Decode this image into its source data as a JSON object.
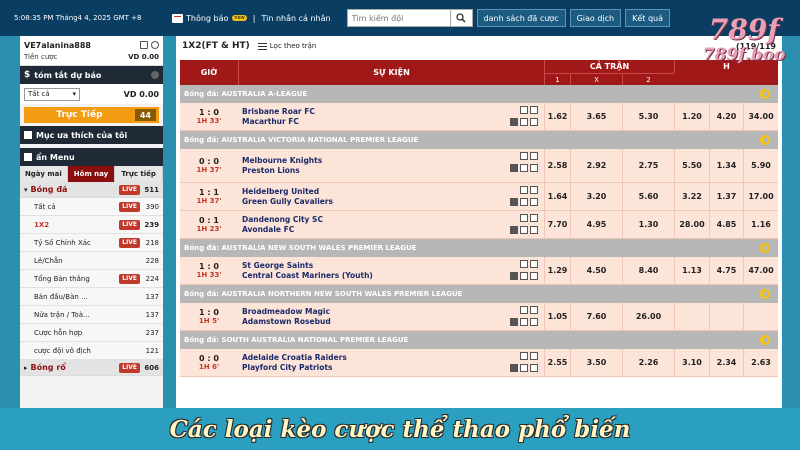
{
  "topbar": {
    "datetime": "5:08:35 PM Tháng4 4, 2025 GMT +8",
    "notice_label": "Thông báo",
    "notice_badge": "new",
    "separator": "|",
    "messages_label": "Tin nhắn cá nhân",
    "search_placeholder": "Tìm kiếm đội",
    "buttons": [
      "danh sách đã cược",
      "Giao dịch",
      "Kết quả"
    ]
  },
  "logo": {
    "line1": "789f",
    "line2": "789f.boo"
  },
  "sidebar": {
    "account_name": "VE7alanina888",
    "balance_label": "Tiền cược",
    "balance_value": "VD 0.00",
    "summary_title": "tóm tắt dự báo",
    "bet_filter_value": "Tất cả",
    "bet_filter_amount": "VD 0.00",
    "live_label": "Trực Tiếp",
    "live_count": "44",
    "favorites_title": "Mục ưa thích của tôi",
    "menu_title": "ẩn Menu",
    "tabs": [
      "Ngày mai",
      "Hôm nay",
      "Trực tiếp"
    ],
    "sports": [
      {
        "name": "Bóng đá",
        "live": "LIVE",
        "count": "511"
      },
      {
        "name": "Bóng rổ",
        "live": "LIVE",
        "count": "606"
      }
    ],
    "markets": [
      {
        "name": "Tất cả",
        "live": "LIVE",
        "count": "390"
      },
      {
        "name": "1X2",
        "live": "LIVE",
        "count": "239"
      },
      {
        "name": "Tỷ Số Chính Xác",
        "live": "LIVE",
        "count": "218"
      },
      {
        "name": "Lẻ/Chẵn",
        "live": "",
        "count": "228"
      },
      {
        "name": "Tổng Bàn thắng",
        "live": "LIVE",
        "count": "224"
      },
      {
        "name": "Bàn đầu/Bàn ...",
        "live": "",
        "count": "137"
      },
      {
        "name": "Nửa trận / Toà...",
        "live": "",
        "count": "137"
      },
      {
        "name": "Cược hỗn hợp",
        "live": "",
        "count": "237"
      },
      {
        "name": "cược đội vô địch",
        "live": "",
        "count": "121"
      }
    ]
  },
  "main": {
    "title": "1X2(FT & HT)",
    "filter_label": "Lọc theo trận",
    "page_count": "(119/119",
    "headers": {
      "time": "GIỜ",
      "event": "SỰ KIỆN",
      "full_match": "CẢ TRẬN",
      "half": "H",
      "cols": [
        "1",
        "X",
        "2"
      ]
    },
    "groups": [
      {
        "league": "Bóng đá: AUSTRALIA A-LEAGUE",
        "matches": [
          {
            "score": "1 : 0",
            "period": "1H 33'",
            "home": "Brisbane Roar FC",
            "away": "Macarthur FC",
            "odds": [
              "1.62",
              "3.65",
              "5.30",
              "1.20",
              "4.20",
              "34.00"
            ]
          }
        ]
      },
      {
        "league": "Bóng đá: AUSTRALIA VICTORIA NATIONAL PREMIER LEAGUE",
        "matches": [
          {
            "score": "0 : 0",
            "period": "1H 37'",
            "home": "Melbourne Knights",
            "away": "Preston Lions",
            "odds": [
              "2.58",
              "2.92",
              "2.75",
              "5.50",
              "1.34",
              "5.90"
            ]
          },
          {
            "score": "1 : 1",
            "period": "1H 37'",
            "home": "Heidelberg United",
            "away": "Green Gully Cavaliers",
            "odds": [
              "1.64",
              "3.20",
              "5.60",
              "3.22",
              "1.37",
              "17.00"
            ]
          },
          {
            "score": "0 : 1",
            "period": "1H 23'",
            "home": "Dandenong City SC",
            "away": "Avondale FC",
            "odds": [
              "7.70",
              "4.95",
              "1.30",
              "28.00",
              "4.85",
              "1.16"
            ]
          }
        ]
      },
      {
        "league": "Bóng đá: AUSTRALIA NEW SOUTH WALES PREMIER LEAGUE",
        "matches": [
          {
            "score": "1 : 0",
            "period": "1H 33'",
            "home": "St George Saints",
            "away": "Central Coast Mariners (Youth)",
            "odds": [
              "1.29",
              "4.50",
              "8.40",
              "1.13",
              "4.75",
              "47.00"
            ]
          }
        ]
      },
      {
        "league": "Bóng đá: AUSTRALIA NORTHERN NEW SOUTH WALES PREMIER LEAGUE",
        "matches": [
          {
            "score": "1 : 0",
            "period": "1H 5'",
            "home": "Broadmeadow Magic",
            "away": "Adamstown Rosebud",
            "odds": [
              "1.05",
              "7.60",
              "26.00",
              "",
              "",
              ""
            ]
          }
        ]
      },
      {
        "league": "Bóng đá: SOUTH AUSTRALIA NATIONAL PREMIER LEAGUE",
        "matches": [
          {
            "score": "0 : 0",
            "period": "1H 6'",
            "home": "Adelaide Croatia Raiders",
            "away": "Playford City Patriots",
            "odds": [
              "2.55",
              "3.50",
              "2.26",
              "3.10",
              "2.34",
              "2.63"
            ]
          }
        ]
      }
    ]
  },
  "caption": "Các loại kèo cược thể thao phổ biến",
  "colors": {
    "header_red": "#a01818",
    "row_bg": "#fde4d8",
    "league_bg": "#b7b7b7",
    "live_orange": "#f39c12",
    "topbar": "#0a3d62"
  }
}
